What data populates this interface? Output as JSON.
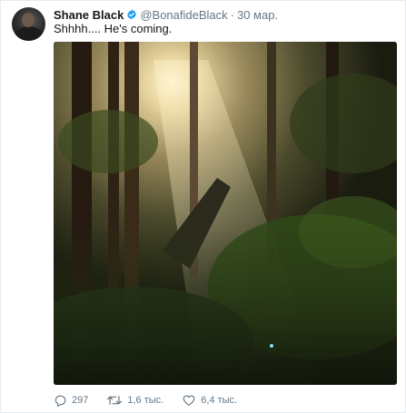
{
  "tweet": {
    "author_name": "Shane Black",
    "author_handle": "@BonafideBlack",
    "separator": "·",
    "time": "30 мар.",
    "text": "Shhhh.... He's coming.",
    "media": {
      "description_icon": "forest-photo"
    },
    "actions": {
      "replies": "297",
      "retweets": "1,6 тыс.",
      "likes": "6,4 тыс."
    }
  },
  "colors": {
    "verified": "#1da1f2",
    "secondary_text": "#657786",
    "primary_text": "#14171a"
  }
}
